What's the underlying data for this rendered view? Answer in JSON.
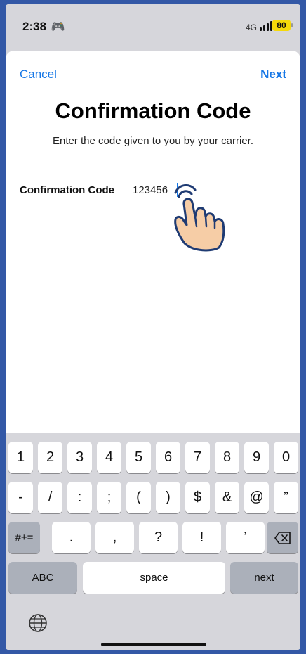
{
  "status": {
    "time": "2:38",
    "network": "4G",
    "battery": "80"
  },
  "nav": {
    "cancel": "Cancel",
    "next": "Next"
  },
  "title": "Confirmation Code",
  "subtitle": "Enter the code given to you by your carrier.",
  "field": {
    "label": "Confirmation Code",
    "value": "123456"
  },
  "keyboard": {
    "row1": [
      "1",
      "2",
      "3",
      "4",
      "5",
      "6",
      "7",
      "8",
      "9",
      "0"
    ],
    "row2": [
      "-",
      "/",
      ":",
      ";",
      "(",
      ")",
      "$",
      "&",
      "@",
      "”"
    ],
    "row3_mode": "#+=",
    "row3": [
      ".",
      ",",
      "?",
      "!",
      "’"
    ],
    "abc": "ABC",
    "space": "space",
    "next": "next"
  },
  "colors": {
    "accent": "#1677e6",
    "frame": "#3358a6",
    "keyboard_bg": "#d6d6db",
    "battery": "#f5d90a"
  },
  "icons": [
    "game-controller-icon",
    "signal-icon",
    "battery-icon",
    "backspace-icon",
    "globe-icon",
    "tap-hand-icon"
  ]
}
